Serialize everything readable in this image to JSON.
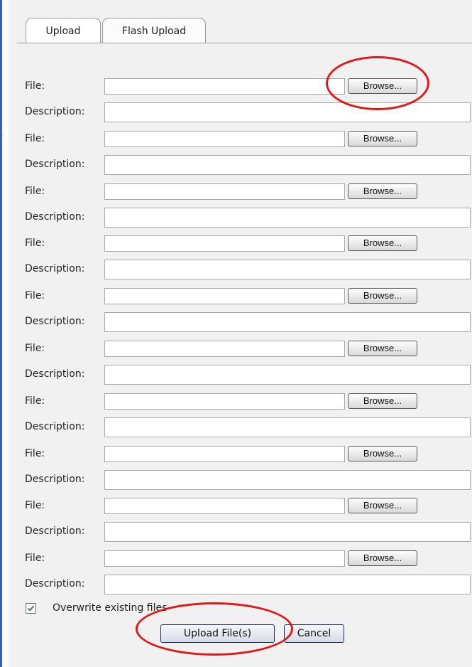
{
  "tabs": [
    {
      "label": "Upload"
    },
    {
      "label": "Flash Upload"
    }
  ],
  "labels": {
    "file": "File:",
    "description": "Description:"
  },
  "browse_label": "Browse...",
  "rows": [
    {
      "file_value": "",
      "description_value": ""
    },
    {
      "file_value": "",
      "description_value": ""
    },
    {
      "file_value": "",
      "description_value": ""
    },
    {
      "file_value": "",
      "description_value": ""
    },
    {
      "file_value": "",
      "description_value": ""
    },
    {
      "file_value": "",
      "description_value": ""
    },
    {
      "file_value": "",
      "description_value": ""
    },
    {
      "file_value": "",
      "description_value": ""
    },
    {
      "file_value": "",
      "description_value": ""
    },
    {
      "file_value": "",
      "description_value": ""
    }
  ],
  "overwrite": {
    "label": "Overwrite existing files",
    "checked": true
  },
  "actions": {
    "upload_label": "Upload File(s)",
    "cancel_label": "Cancel"
  },
  "colors": {
    "annotation": "#e01818",
    "checkmark": "#2f8a2f",
    "left_rule": "#3a5fb8"
  }
}
